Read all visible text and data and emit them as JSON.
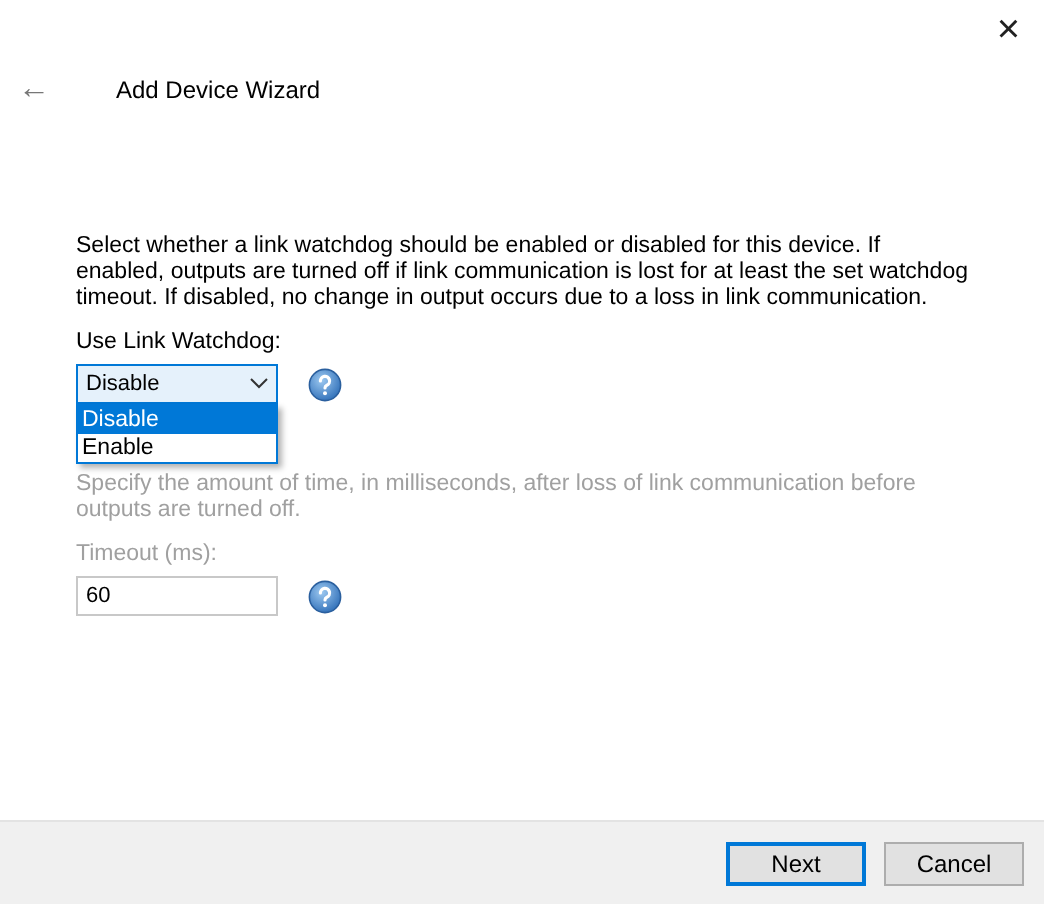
{
  "window": {
    "close_glyph": "×"
  },
  "header": {
    "back_glyph": "←",
    "title": "Add Device Wizard"
  },
  "description": "Select whether a link watchdog should be enabled or disabled for this device. If enabled, outputs are turned off if link communication is lost for at least the set watchdog timeout. If disabled, no change in output occurs due to a loss in link communication.",
  "watchdog": {
    "label": "Use Link Watchdog:",
    "value": "Disable",
    "expanded": true,
    "options": [
      {
        "label": "Disable",
        "selected": true
      },
      {
        "label": "Enable",
        "selected": false
      }
    ]
  },
  "timeout": {
    "disabled": true,
    "description": "Specify the amount of time, in milliseconds, after loss of link communication before outputs are turned off.",
    "label": "Timeout (ms):",
    "value": "60"
  },
  "buttons": [
    {
      "label": "Next",
      "default": true
    },
    {
      "label": "Cancel",
      "default": false
    }
  ]
}
